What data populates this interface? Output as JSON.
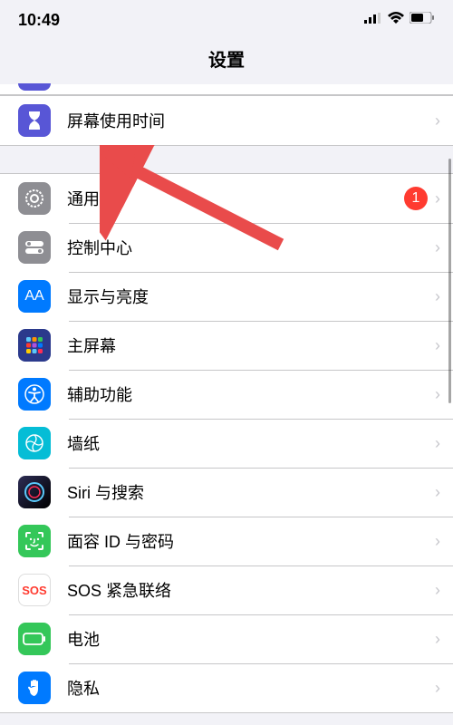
{
  "status": {
    "time": "10:49"
  },
  "page": {
    "title": "设置"
  },
  "section1": {
    "items": [
      {
        "label": "屏幕使用时间"
      }
    ]
  },
  "section2": {
    "items": [
      {
        "label": "通用",
        "badge": "1"
      },
      {
        "label": "控制中心"
      },
      {
        "label": "显示与亮度"
      },
      {
        "label": "主屏幕"
      },
      {
        "label": "辅助功能"
      },
      {
        "label": "墙纸"
      },
      {
        "label": "Siri 与搜索"
      },
      {
        "label": "面容 ID 与密码"
      },
      {
        "label": "SOS 紧急联络"
      },
      {
        "label": "电池"
      },
      {
        "label": "隐私"
      }
    ]
  },
  "icon_text": {
    "aa": "AA",
    "sos": "SOS"
  }
}
